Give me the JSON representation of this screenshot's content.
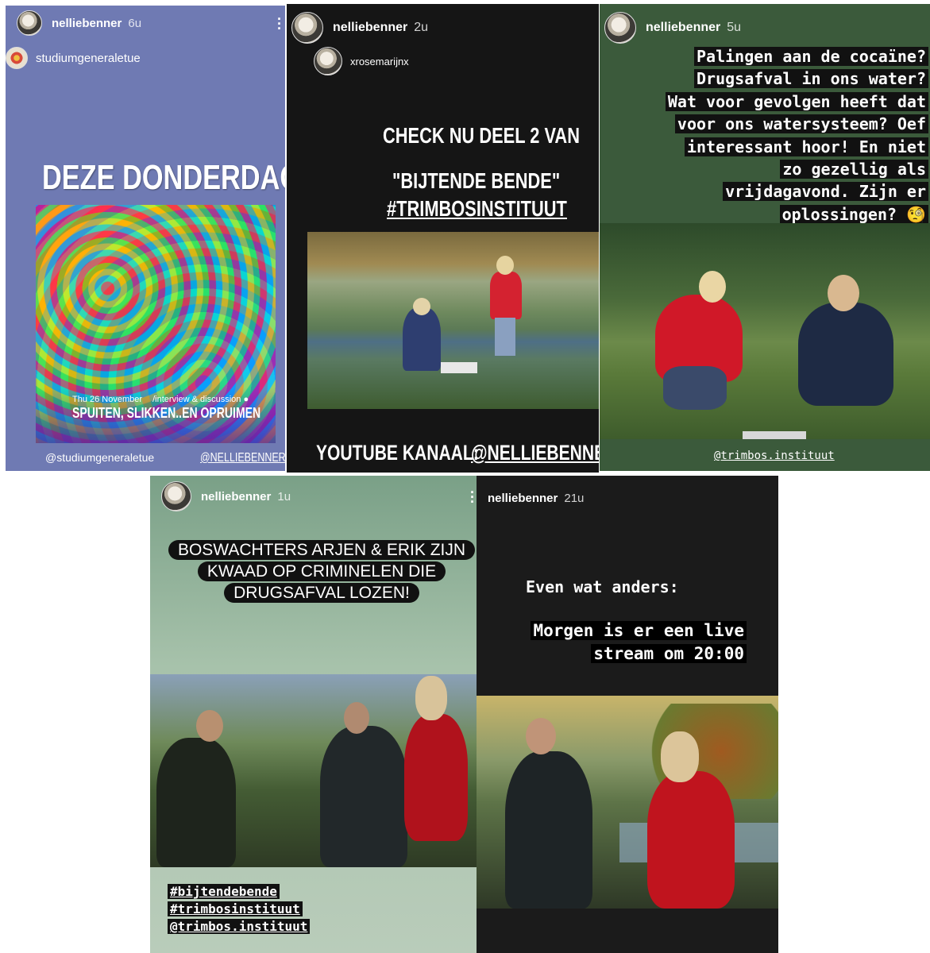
{
  "stories": [
    {
      "username": "nelliebenner",
      "time": "6u",
      "repost_account": "studiumgeneraletue",
      "headline": "DEZE DONDERDAG!",
      "poster": {
        "date": "Thu 26 November",
        "type": "/interview & discussion",
        "title": "SPUITEN, SLIKKEN..EN OPRUIMEN"
      },
      "tag_left": "@studiumgeneraletue",
      "tag_right": "@NELLIEBENNER",
      "bg_color": "#6f7ab3"
    },
    {
      "username": "nelliebenner",
      "time": "2u",
      "repost_account": "xrosemarijnx",
      "line1": "CHECK NU DEEL 2 VAN",
      "line2": "\"BIJTENDE BENDE\"",
      "line3": "#TRIMBOSINSTITUUT",
      "footer_label": "YOUTUBE KANAAL:",
      "footer_handle": "@NELLIEBENNER",
      "bg_color": "#151515"
    },
    {
      "username": "nelliebenner",
      "time": "5u",
      "caption_lines": [
        "Palingen  aan de cocaïne?",
        "Drugsafval in ons water?",
        "Wat voor gevolgen heeft dat",
        "voor ons watersysteem? Oef",
        "interessant hoor! En niet",
        "zo gezellig als",
        "vrijdagavond. Zijn er",
        "oplossingen? 🧐"
      ],
      "tag": "@trimbos.instituut",
      "bg_color": "#3b5a3b"
    },
    {
      "username": "nelliebenner",
      "time": "1u",
      "caption_lines": [
        "BOSWACHTERS ARJEN & ERIK ZIJN",
        "KWAAD OP CRIMINELEN DIE",
        "DRUGSAFVAL LOZEN!"
      ],
      "hashtags": [
        "#bijtendebende",
        "#trimbosinstituut",
        "@trimbos.instituut"
      ],
      "bg_color": "#8fae95"
    },
    {
      "username": "nelliebenner",
      "time": "21u",
      "line1": "Even wat anders:",
      "line2": "Morgen is er een live",
      "line3": "stream om 20:00",
      "bg_color": "#1b1b1b"
    }
  ],
  "icons": {
    "more": "more-vertical-icon",
    "avatar": "profile-avatar"
  }
}
